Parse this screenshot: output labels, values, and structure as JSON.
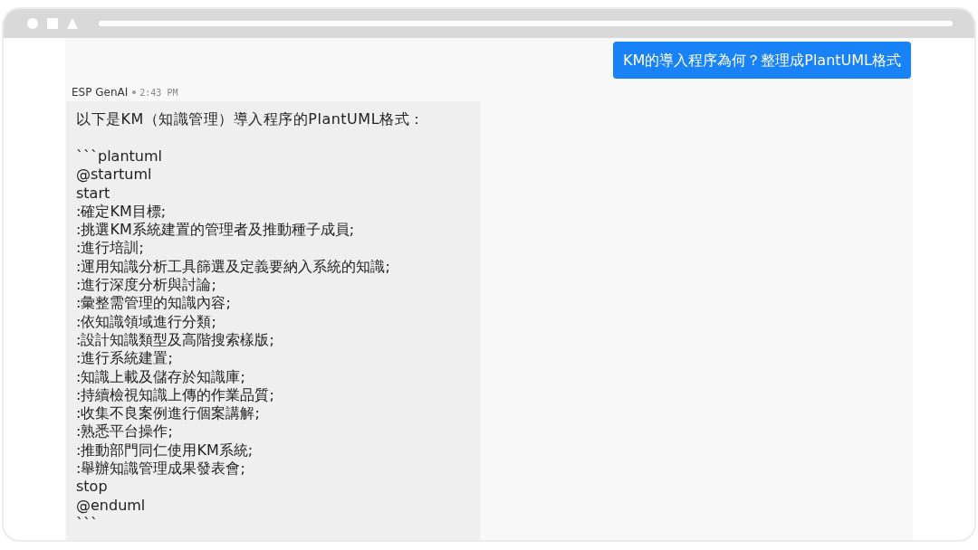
{
  "messages": [
    {
      "kind": "user",
      "text": "KM的導入程序為何？整理成PlantUML格式"
    },
    {
      "kind": "assistant",
      "sender": "ESP GenAI",
      "time": "2:43 PM",
      "intro": "以下是KM（知識管理）導入程序的PlantUML格式：",
      "code_lines": [
        "```plantuml",
        "@startuml",
        "start",
        ":確定KM目標;",
        ":挑選KM系統建置的管理者及推動種子成員;",
        ":進行培訓;",
        ":運用知識分析工具篩選及定義要納入系統的知識;",
        ":進行深度分析與討論;",
        ":彙整需管理的知識內容;",
        ":依知識領域進行分類;",
        ":設計知識類型及高階搜索樣版;",
        ":進行系統建置;",
        ":知識上載及儲存於知識庫;",
        ":持續檢視知識上傳的作業品質;",
        ":收集不良案例進行個案講解;",
        ":熟悉平台操作;",
        ":推動部門同仁使用KM系統;",
        ":舉辦知識管理成果發表會;",
        "stop",
        "@enduml",
        "```"
      ]
    }
  ]
}
